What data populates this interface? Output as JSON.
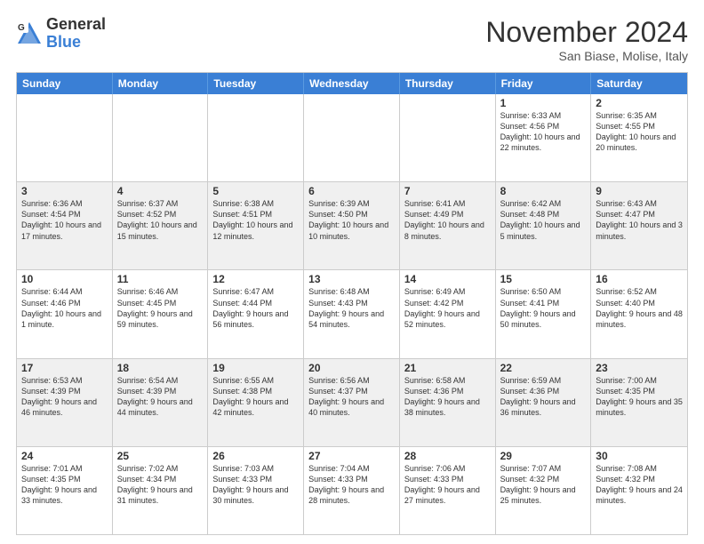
{
  "logo": {
    "general": "General",
    "blue": "Blue"
  },
  "title": "November 2024",
  "location": "San Biase, Molise, Italy",
  "header": {
    "days": [
      "Sunday",
      "Monday",
      "Tuesday",
      "Wednesday",
      "Thursday",
      "Friday",
      "Saturday"
    ]
  },
  "rows": [
    [
      {
        "day": "",
        "info": ""
      },
      {
        "day": "",
        "info": ""
      },
      {
        "day": "",
        "info": ""
      },
      {
        "day": "",
        "info": ""
      },
      {
        "day": "",
        "info": ""
      },
      {
        "day": "1",
        "info": "Sunrise: 6:33 AM\nSunset: 4:56 PM\nDaylight: 10 hours and 22 minutes."
      },
      {
        "day": "2",
        "info": "Sunrise: 6:35 AM\nSunset: 4:55 PM\nDaylight: 10 hours and 20 minutes."
      }
    ],
    [
      {
        "day": "3",
        "info": "Sunrise: 6:36 AM\nSunset: 4:54 PM\nDaylight: 10 hours and 17 minutes."
      },
      {
        "day": "4",
        "info": "Sunrise: 6:37 AM\nSunset: 4:52 PM\nDaylight: 10 hours and 15 minutes."
      },
      {
        "day": "5",
        "info": "Sunrise: 6:38 AM\nSunset: 4:51 PM\nDaylight: 10 hours and 12 minutes."
      },
      {
        "day": "6",
        "info": "Sunrise: 6:39 AM\nSunset: 4:50 PM\nDaylight: 10 hours and 10 minutes."
      },
      {
        "day": "7",
        "info": "Sunrise: 6:41 AM\nSunset: 4:49 PM\nDaylight: 10 hours and 8 minutes."
      },
      {
        "day": "8",
        "info": "Sunrise: 6:42 AM\nSunset: 4:48 PM\nDaylight: 10 hours and 5 minutes."
      },
      {
        "day": "9",
        "info": "Sunrise: 6:43 AM\nSunset: 4:47 PM\nDaylight: 10 hours and 3 minutes."
      }
    ],
    [
      {
        "day": "10",
        "info": "Sunrise: 6:44 AM\nSunset: 4:46 PM\nDaylight: 10 hours and 1 minute."
      },
      {
        "day": "11",
        "info": "Sunrise: 6:46 AM\nSunset: 4:45 PM\nDaylight: 9 hours and 59 minutes."
      },
      {
        "day": "12",
        "info": "Sunrise: 6:47 AM\nSunset: 4:44 PM\nDaylight: 9 hours and 56 minutes."
      },
      {
        "day": "13",
        "info": "Sunrise: 6:48 AM\nSunset: 4:43 PM\nDaylight: 9 hours and 54 minutes."
      },
      {
        "day": "14",
        "info": "Sunrise: 6:49 AM\nSunset: 4:42 PM\nDaylight: 9 hours and 52 minutes."
      },
      {
        "day": "15",
        "info": "Sunrise: 6:50 AM\nSunset: 4:41 PM\nDaylight: 9 hours and 50 minutes."
      },
      {
        "day": "16",
        "info": "Sunrise: 6:52 AM\nSunset: 4:40 PM\nDaylight: 9 hours and 48 minutes."
      }
    ],
    [
      {
        "day": "17",
        "info": "Sunrise: 6:53 AM\nSunset: 4:39 PM\nDaylight: 9 hours and 46 minutes."
      },
      {
        "day": "18",
        "info": "Sunrise: 6:54 AM\nSunset: 4:39 PM\nDaylight: 9 hours and 44 minutes."
      },
      {
        "day": "19",
        "info": "Sunrise: 6:55 AM\nSunset: 4:38 PM\nDaylight: 9 hours and 42 minutes."
      },
      {
        "day": "20",
        "info": "Sunrise: 6:56 AM\nSunset: 4:37 PM\nDaylight: 9 hours and 40 minutes."
      },
      {
        "day": "21",
        "info": "Sunrise: 6:58 AM\nSunset: 4:36 PM\nDaylight: 9 hours and 38 minutes."
      },
      {
        "day": "22",
        "info": "Sunrise: 6:59 AM\nSunset: 4:36 PM\nDaylight: 9 hours and 36 minutes."
      },
      {
        "day": "23",
        "info": "Sunrise: 7:00 AM\nSunset: 4:35 PM\nDaylight: 9 hours and 35 minutes."
      }
    ],
    [
      {
        "day": "24",
        "info": "Sunrise: 7:01 AM\nSunset: 4:35 PM\nDaylight: 9 hours and 33 minutes."
      },
      {
        "day": "25",
        "info": "Sunrise: 7:02 AM\nSunset: 4:34 PM\nDaylight: 9 hours and 31 minutes."
      },
      {
        "day": "26",
        "info": "Sunrise: 7:03 AM\nSunset: 4:33 PM\nDaylight: 9 hours and 30 minutes."
      },
      {
        "day": "27",
        "info": "Sunrise: 7:04 AM\nSunset: 4:33 PM\nDaylight: 9 hours and 28 minutes."
      },
      {
        "day": "28",
        "info": "Sunrise: 7:06 AM\nSunset: 4:33 PM\nDaylight: 9 hours and 27 minutes."
      },
      {
        "day": "29",
        "info": "Sunrise: 7:07 AM\nSunset: 4:32 PM\nDaylight: 9 hours and 25 minutes."
      },
      {
        "day": "30",
        "info": "Sunrise: 7:08 AM\nSunset: 4:32 PM\nDaylight: 9 hours and 24 minutes."
      }
    ]
  ]
}
